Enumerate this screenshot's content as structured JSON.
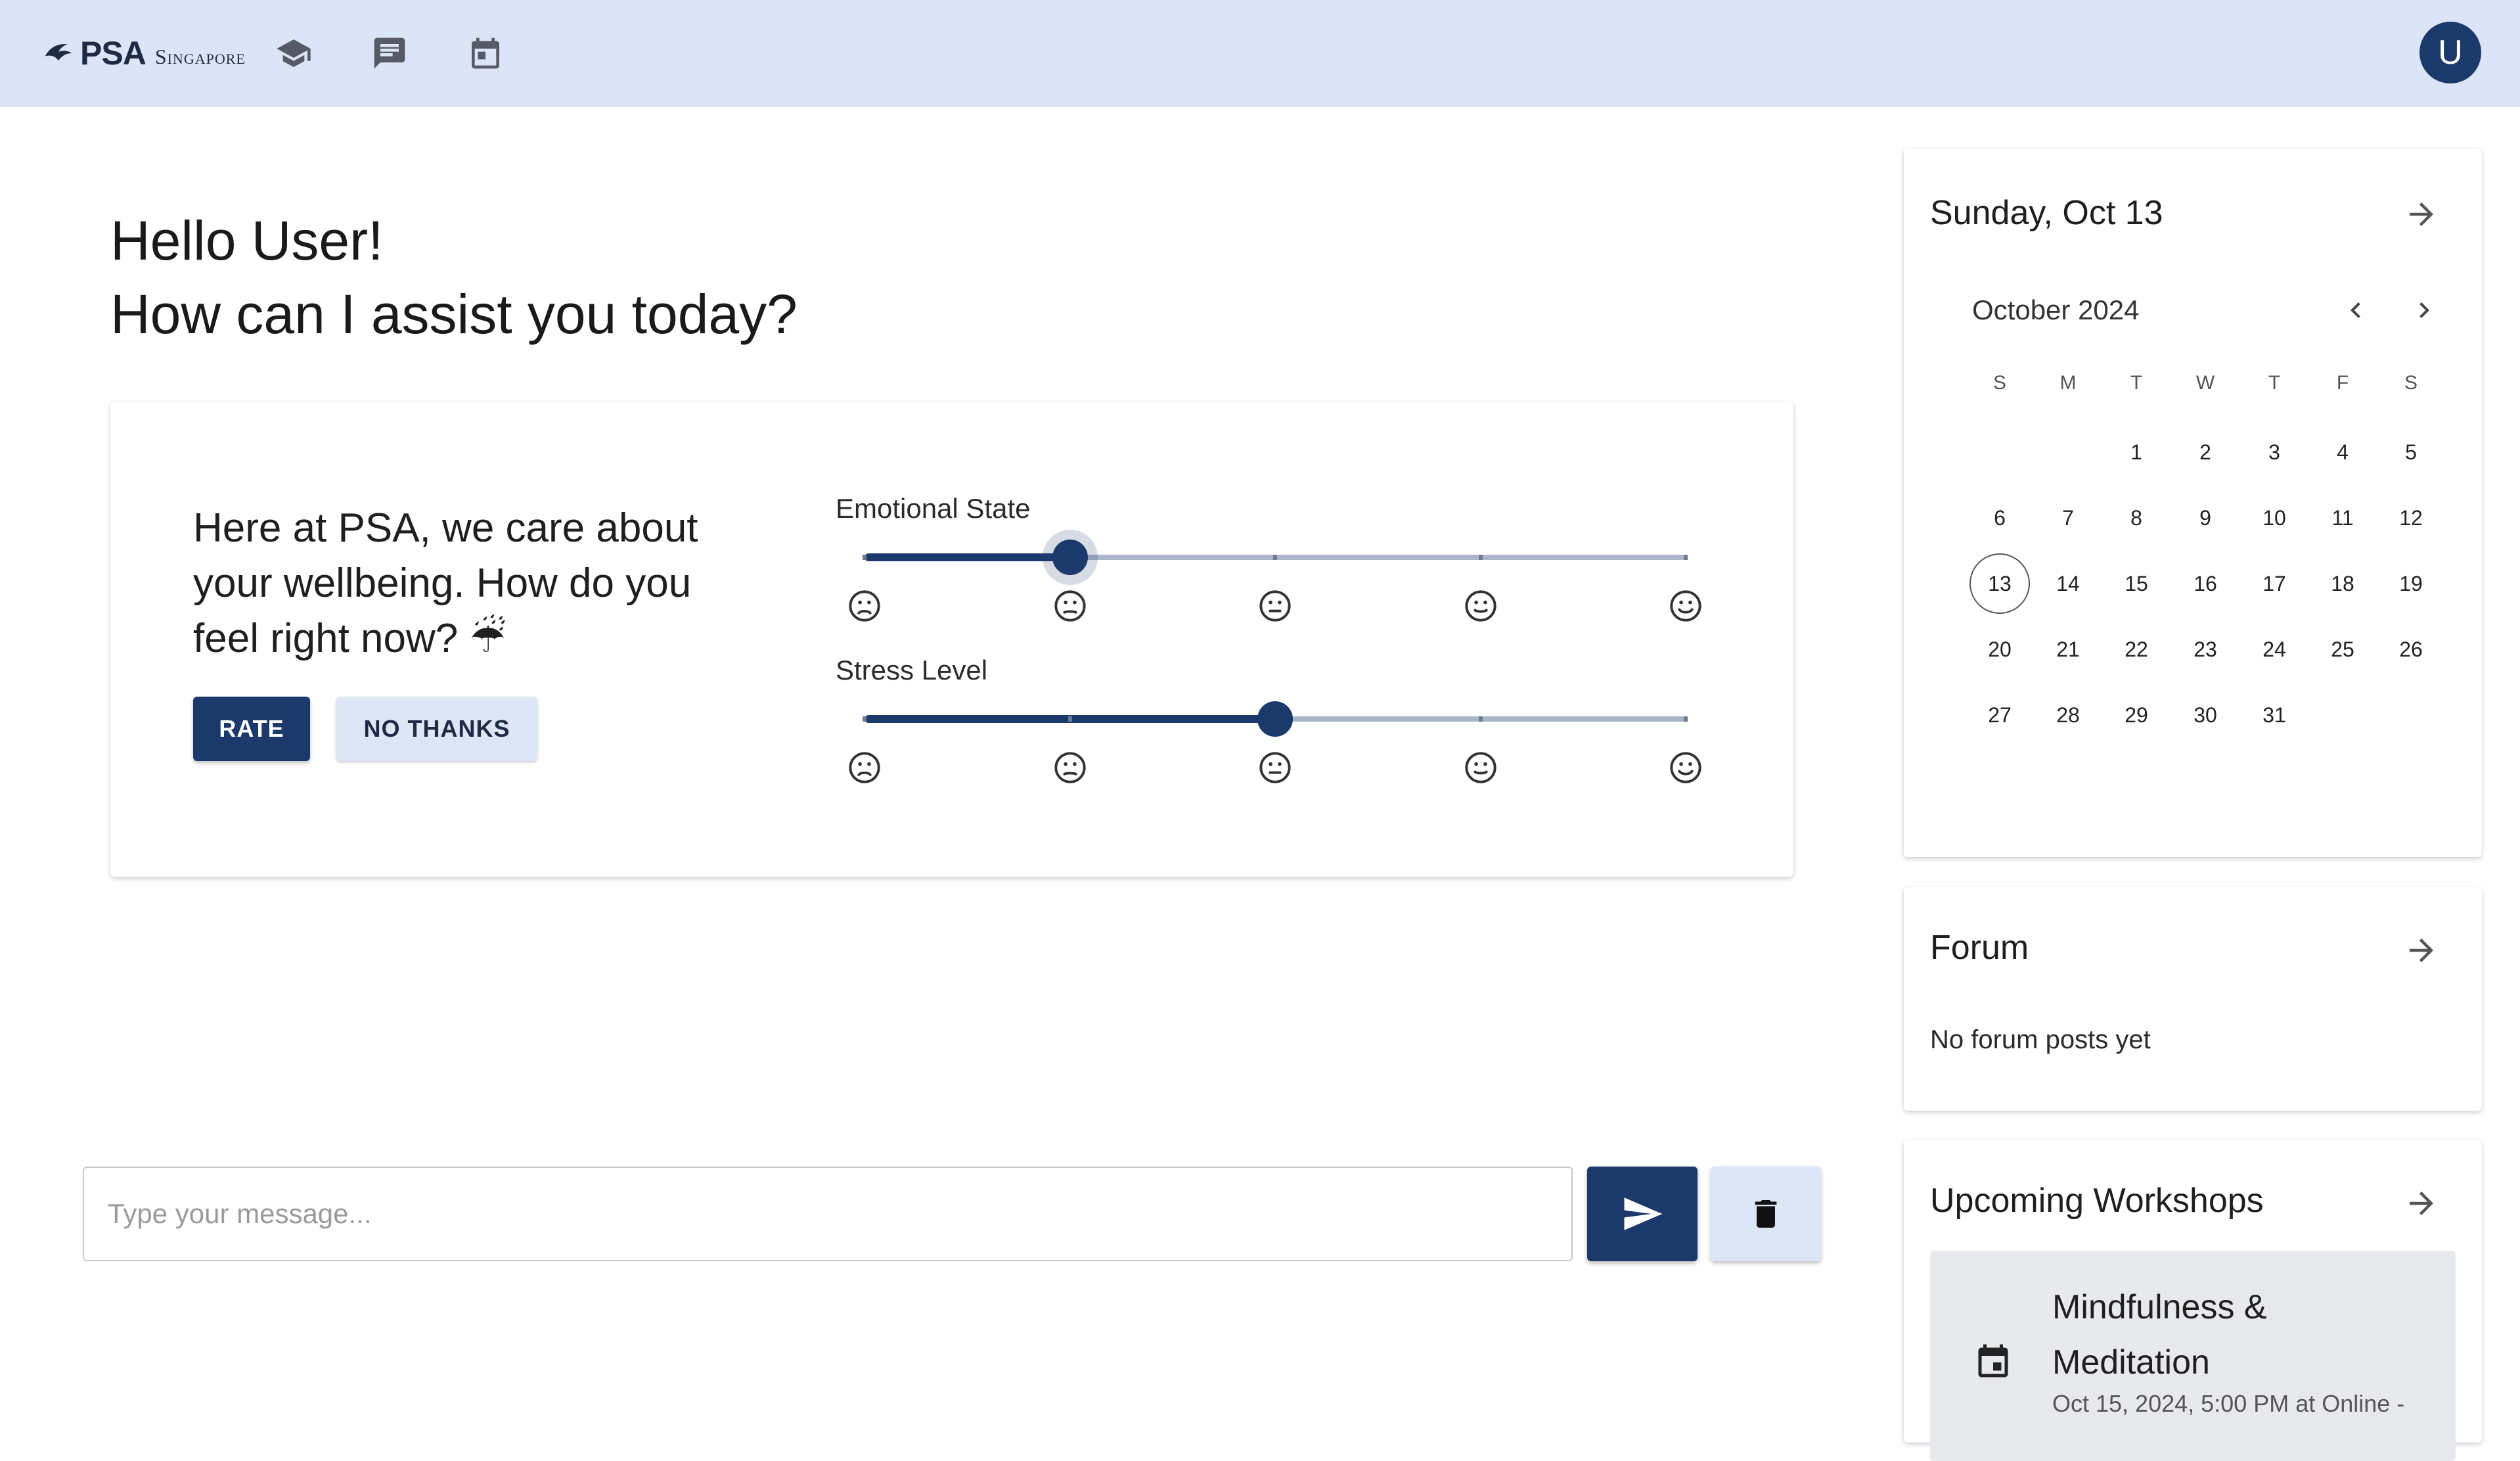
{
  "header": {
    "logo_text": "PSA",
    "logo_subtext": "Singapore",
    "nav_icons": [
      "graduation-cap-icon",
      "chat-icon",
      "calendar-icon"
    ],
    "avatar_initial": "U",
    "background": "#dce5f7"
  },
  "greeting": {
    "line1": "Hello User!",
    "line2": "How can I assist you today?"
  },
  "wellbeing": {
    "prompt": "Here at PSA, we care about your wellbeing. How do you feel right now? ☔",
    "rate_label": "RATE",
    "no_thanks_label": "NO THANKS",
    "sliders": [
      {
        "label": "Emotional State",
        "value": 2,
        "min": 1,
        "max": 5
      },
      {
        "label": "Stress Level",
        "value": 3,
        "min": 1,
        "max": 5
      }
    ]
  },
  "chat": {
    "placeholder": "Type your message...",
    "send_icon": "send-icon",
    "clear_icon": "trash-icon"
  },
  "calendar": {
    "date_heading": "Sunday, Oct 13",
    "month_label": "October 2024",
    "weekdays": [
      "S",
      "M",
      "T",
      "W",
      "T",
      "F",
      "S"
    ],
    "first_weekday_index": 2,
    "days_in_month": 31,
    "today": 13
  },
  "forum": {
    "title": "Forum",
    "empty_text": "No forum posts yet"
  },
  "workshops": {
    "title": "Upcoming Workshops",
    "items": [
      {
        "title": "Mindfulness & Meditation",
        "meta": "Oct 15, 2024, 5:00 PM at Online -"
      }
    ]
  },
  "colors": {
    "primary": "#1b3a6b",
    "secondary_button": "#dde6f5"
  }
}
